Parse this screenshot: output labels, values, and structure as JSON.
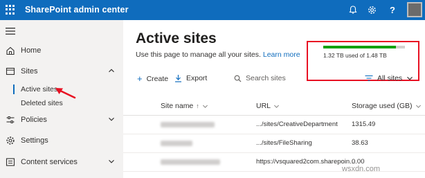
{
  "header": {
    "app_title": "SharePoint admin center",
    "icons": [
      "waffle-icon",
      "bell-icon",
      "gear-icon",
      "help-icon"
    ],
    "accent": "#0f6cbd"
  },
  "nav": {
    "items": [
      {
        "label": "Home",
        "icon": "home-icon"
      },
      {
        "label": "Sites",
        "icon": "sites-icon",
        "expanded": true
      },
      {
        "label": "Policies",
        "icon": "policies-icon",
        "expanded": false
      },
      {
        "label": "Settings",
        "icon": "gear-icon"
      },
      {
        "label": "Content services",
        "icon": "content-services-icon",
        "expanded": false
      }
    ],
    "sub_items": [
      {
        "label": "Active sites",
        "selected": true
      },
      {
        "label": "Deleted sites",
        "selected": false
      }
    ]
  },
  "main": {
    "title": "Active sites",
    "description": "Use this page to manage all your sites.",
    "learn_more": "Learn more",
    "storage": {
      "label": "1.32 TB used of 1.48 TB",
      "used_fraction": 0.892,
      "bar_color": "#13a10e",
      "highlight_color": "#e81123"
    },
    "commands": {
      "create": "Create",
      "export": "Export",
      "search_placeholder": "Search sites",
      "filter": "All sites"
    },
    "table": {
      "columns": [
        "Site name",
        "URL",
        "Storage used (GB)"
      ],
      "rows": [
        {
          "url": ".../sites/CreativeDepartment",
          "storage": "1315.49"
        },
        {
          "url": ".../sites/FileSharing",
          "storage": "38.63"
        },
        {
          "url": "https://vsquared2com.sharepoin...",
          "storage": "0.00"
        }
      ]
    }
  },
  "watermark": "wsxdn.com"
}
